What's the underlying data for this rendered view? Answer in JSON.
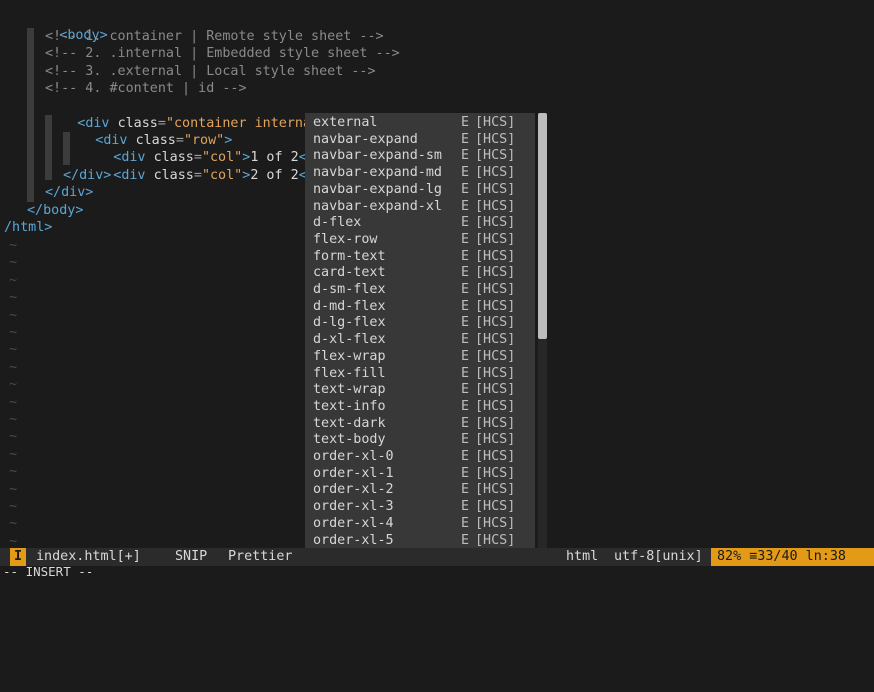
{
  "editor": {
    "lines": {
      "l1": {
        "tag": "body"
      },
      "l2": "<!-- 1. container | Remote style sheet -->",
      "l3": "<!-- 2. .internal | Embedded style sheet -->",
      "l4": "<!-- 3. .external | Local style sheet -->",
      "l5": "<!-- 4. #content | id -->",
      "l6": {
        "tag": "div",
        "attr": "class",
        "value": "\"container internal ex"
      },
      "l7": {
        "tag": "div",
        "attr": "class",
        "value": "\"row\""
      },
      "l8": {
        "tag": "div",
        "attr": "class",
        "value": "\"col\"",
        "text": "1 of 2",
        "close_partial": "</d"
      },
      "l9": {
        "tag": "div",
        "attr": "class",
        "value": "\"col\"",
        "text": "2 of 2",
        "close_partial": "</d"
      },
      "l10": "</div>",
      "l11": "</div>",
      "l12": "</body>",
      "l13": "/html>"
    },
    "tilde": "~"
  },
  "completion": {
    "kind": "E",
    "menu": "[HCS]",
    "items": [
      "external",
      "navbar-expand",
      "navbar-expand-sm",
      "navbar-expand-md",
      "navbar-expand-lg",
      "navbar-expand-xl",
      "d-flex",
      "flex-row",
      "form-text",
      "card-text",
      "d-sm-flex",
      "d-md-flex",
      "d-lg-flex",
      "d-xl-flex",
      "flex-wrap",
      "flex-fill",
      "text-wrap",
      "text-info",
      "text-dark",
      "text-body",
      "order-xl-0",
      "order-xl-1",
      "order-xl-2",
      "order-xl-3",
      "order-xl-4",
      "order-xl-5"
    ]
  },
  "statusbar": {
    "mode_letter": "I",
    "filename": "index.html[+]",
    "snip": "SNIP",
    "prettier": "Prettier",
    "filetype": "html",
    "encoding": "utf-8[unix]",
    "position": "82% ≡33/40 ln:38"
  },
  "cmdline": "-- INSERT --",
  "colors": {
    "accent": "#e39a16",
    "tag": "#5ca6d6",
    "string": "#e2a35c",
    "background": "#1b1b1b",
    "popup": "#383838"
  }
}
